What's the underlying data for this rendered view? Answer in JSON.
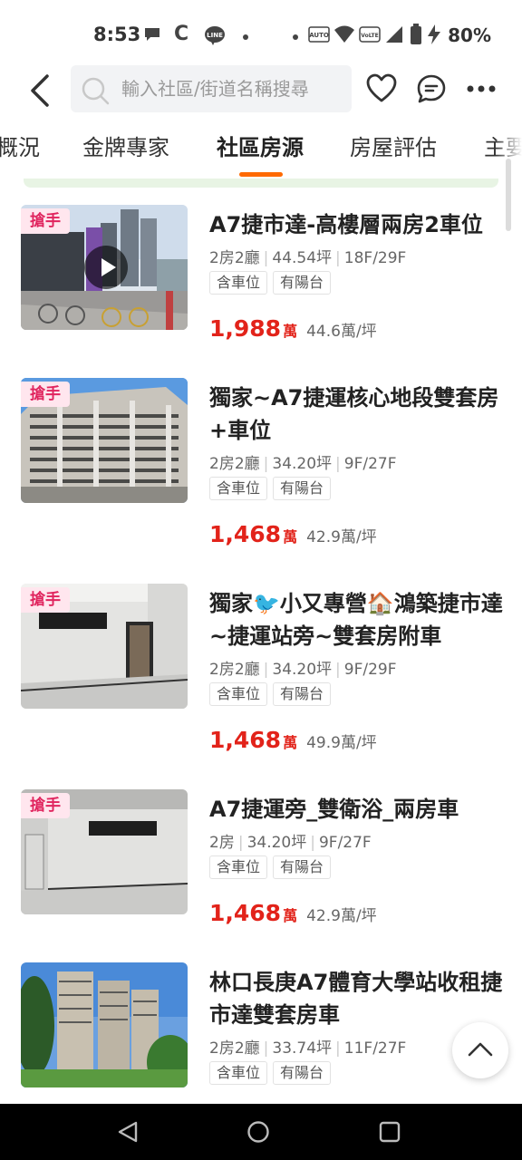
{
  "status_bar": {
    "time": "8:53",
    "battery": "80%",
    "auto_label": "AUTO",
    "volte_label": "VoLTE"
  },
  "search": {
    "placeholder": "輸入社區/街道名稱搜尋"
  },
  "tabs": [
    {
      "label": "概況"
    },
    {
      "label": "金牌專家"
    },
    {
      "label": "社區房源"
    },
    {
      "label": "房屋評估"
    },
    {
      "label": "主要"
    }
  ],
  "listings": [
    {
      "badge": "搶手",
      "title": "A7捷市達-高樓層兩房2車位",
      "layout": "2房2廳",
      "area": "44.54坪",
      "floor": "18F/29F",
      "tags": [
        "含車位",
        "有陽台"
      ],
      "price": "1,988",
      "price_unit": "萬",
      "unit_price": "44.6萬/坪",
      "has_video": true
    },
    {
      "badge": "搶手",
      "title": "獨家~A7捷運核心地段雙套房+車位",
      "layout": "2房2廳",
      "area": "34.20坪",
      "floor": "9F/27F",
      "tags": [
        "含車位",
        "有陽台"
      ],
      "price": "1,468",
      "price_unit": "萬",
      "unit_price": "42.9萬/坪"
    },
    {
      "badge": "搶手",
      "title": "獨家🐦小又專營🏠鴻築捷市達~捷運站旁~雙套房附車",
      "layout": "2房2廳",
      "area": "34.20坪",
      "floor": "9F/29F",
      "tags": [
        "含車位",
        "有陽台"
      ],
      "price": "1,468",
      "price_unit": "萬",
      "unit_price": "49.9萬/坪"
    },
    {
      "badge": "搶手",
      "title": "A7捷運旁_雙衛浴_兩房車",
      "layout": "2房",
      "area": "34.20坪",
      "floor": "9F/27F",
      "tags": [
        "含車位",
        "有陽台"
      ],
      "price": "1,468",
      "price_unit": "萬",
      "unit_price": "42.9萬/坪"
    },
    {
      "title": "林口長庚A7體育大學站收租捷市達雙套房車",
      "layout": "2房2廳",
      "area": "33.74坪",
      "floor": "11F/27F",
      "tags": [
        "含車位",
        "有陽台"
      ]
    }
  ],
  "colors": {
    "accent": "#ff6a00",
    "price": "#e2231a",
    "badge_bg": "#ffe6ee",
    "badge_text": "#e0245e"
  }
}
